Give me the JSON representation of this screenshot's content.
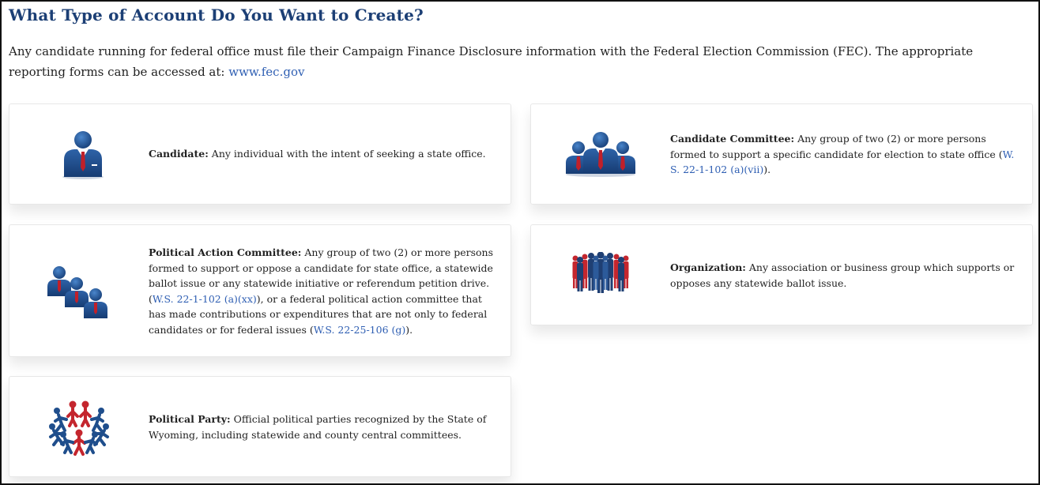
{
  "heading": "What Type of Account Do You Want to Create?",
  "intro": {
    "text": "Any candidate running for federal office must file their Campaign Finance Disclosure information with the Federal Election Commission (FEC). The appropriate reporting forms can be accessed at: ",
    "link": "www.fec.gov"
  },
  "cards": {
    "candidate": {
      "title": "Candidate:",
      "text": " Any individual with the intent of seeking a state office.",
      "icon": "person-icon"
    },
    "committee": {
      "title": "Candidate Committee:",
      "text": " Any group of two (2) or more persons formed to support a specific candidate for election to state office (",
      "link": "W. S. 22-1-102 (a)(vii)",
      "tail": ").",
      "icon": "group-icon"
    },
    "pac": {
      "title": "Political Action Committee:",
      "text1": " Any group of two (2) or more persons formed to support or oppose a candidate for state office, a statewide ballot issue or any statewide initiative or referendum petition drive. (",
      "link1": "W.S. 22-1-102 (a)(xx)",
      "text2": "), or a federal political action committee that has made contributions or expenditures that are not only to federal candidates or for federal issues (",
      "link2": "W.S. 22-25-106 (g)",
      "tail": ").",
      "icon": "committee-icon"
    },
    "organization": {
      "title": "Organization:",
      "text": " Any association or business group which supports or opposes any statewide ballot issue.",
      "icon": "crowd-icon"
    },
    "party": {
      "title": "Political Party:",
      "text": " Official political parties recognized by the State of Wyoming, including statewide and county central committees.",
      "icon": "people-circle-icon"
    }
  },
  "colors": {
    "heading": "#1c3f75",
    "link": "#2f5fb3",
    "navy": "#1f4e8c",
    "red": "#c0202a"
  }
}
